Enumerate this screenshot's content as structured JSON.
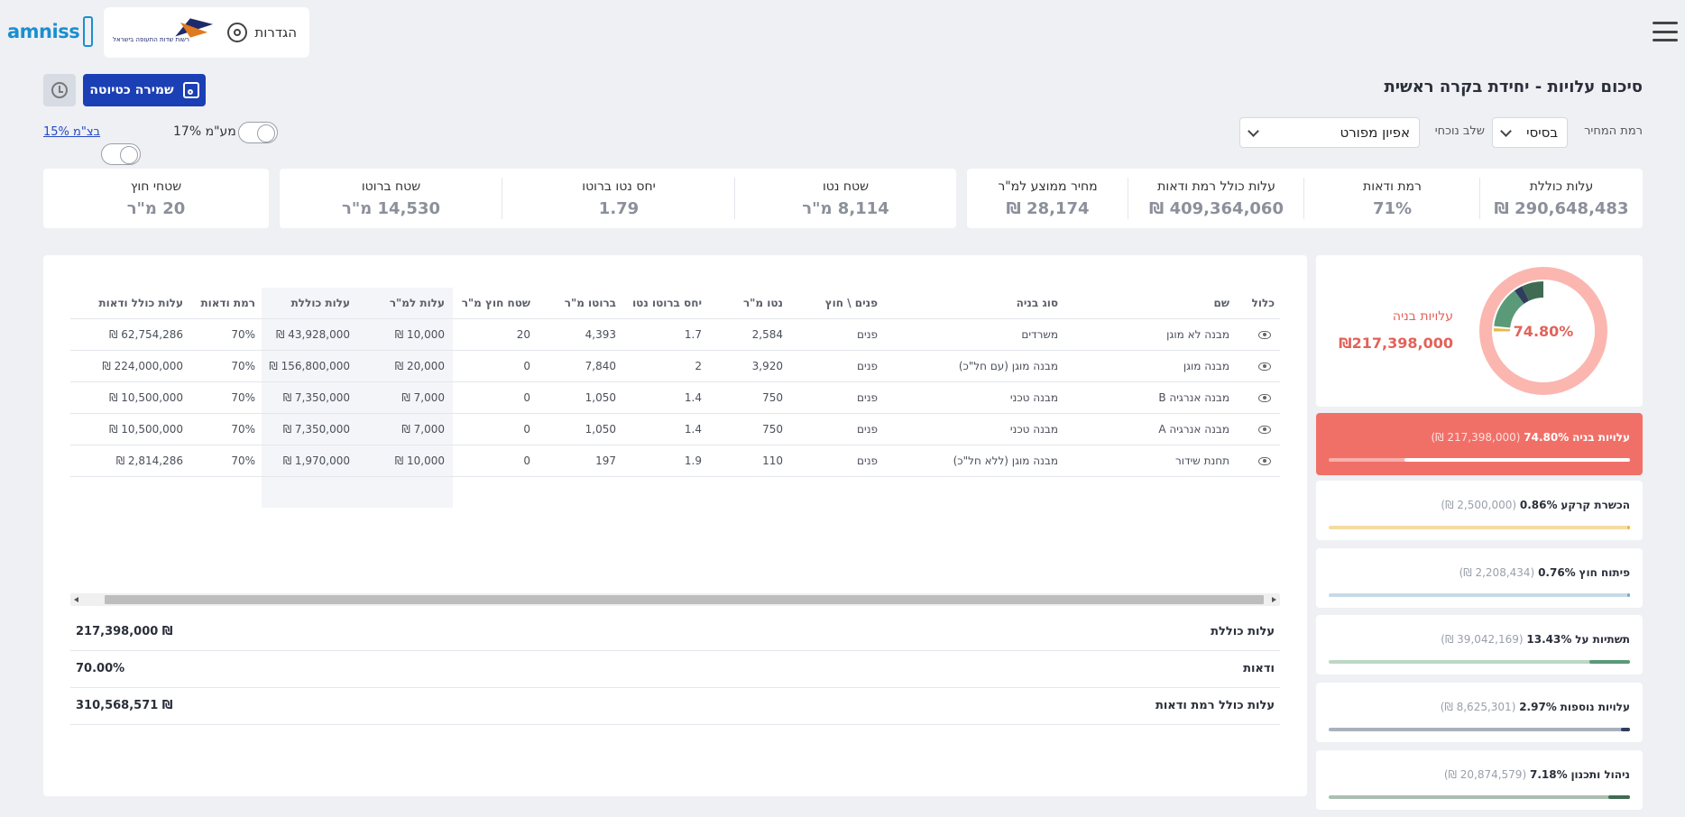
{
  "header": {
    "settings_label": "הגדרות",
    "brand": "amniss",
    "partner_logo_text": "רשות שדות התעופה בישראל",
    "partner_logo_subtext": "ISRAEL AIRPORTS AUTHORITY"
  },
  "toolbar": {
    "page_title": "סיכום עלויות - יחידת בקרה ראשית",
    "save_label": "שמירה כטיוטה",
    "price_level_label": "רמת המחיר",
    "price_level_value": "בסיסי",
    "stage_label": "שלב נוכחי",
    "stage_value": "אפיון מפורט",
    "vat_label": "מע\"מ 17%",
    "contingency_label": "בצ\"מ 15%"
  },
  "stats_a": [
    {
      "label": "עלות כוללת",
      "value": "290,648,483 ₪"
    },
    {
      "label": "רמת ודאות",
      "value": "71%"
    },
    {
      "label": "עלות כולל רמת ודאות",
      "value": "409,364,060 ₪"
    },
    {
      "label": "מחיר ממוצע למ\"ר",
      "value": "28,174 ₪"
    }
  ],
  "stats_b": [
    {
      "label": "שטח נטו",
      "value": "8,114 מ\"ר"
    },
    {
      "label": "יחס נטו ברוטו",
      "value": "1.79"
    },
    {
      "label": "שטח ברוטו",
      "value": "14,530 מ\"ר"
    }
  ],
  "stats_c": [
    {
      "label": "שטחי חוץ",
      "value": "20 מ\"ר"
    }
  ],
  "table": {
    "headers": [
      "כלול",
      "שם",
      "סוג בניה",
      "פנים \\ חוץ",
      "נטו מ\"ר",
      "יחס ברוטו נטו",
      "ברוטו מ\"ר",
      "שטח חוץ מ\"ר",
      "עלות למ\"ר",
      "עלות כוללת",
      "רמת ודאות",
      "עלות כולל ודאות"
    ],
    "rows": [
      [
        "",
        "מבנה לא מוגן",
        "משרדים",
        "פנים",
        "2,584",
        "1.7",
        "4,393",
        "20",
        "10,000 ₪",
        "43,928,000 ₪",
        "70%",
        "62,754,286 ₪"
      ],
      [
        "",
        "מבנה מוגן",
        "מבנה מוגן (עם חל\"כ)",
        "פנים",
        "3,920",
        "2",
        "7,840",
        "0",
        "20,000 ₪",
        "156,800,000 ₪",
        "70%",
        "224,000,000 ₪"
      ],
      [
        "",
        "מבנה אנרגיה B",
        "מבנה טכני",
        "פנים",
        "750",
        "1.4",
        "1,050",
        "0",
        "7,000 ₪",
        "7,350,000 ₪",
        "70%",
        "10,500,000 ₪"
      ],
      [
        "",
        "מבנה אנרגיה A",
        "מבנה טכני",
        "פנים",
        "750",
        "1.4",
        "1,050",
        "0",
        "7,000 ₪",
        "7,350,000 ₪",
        "70%",
        "10,500,000 ₪"
      ],
      [
        "",
        "תחנת שידור",
        "מבנה מוגן (ללא חל\"כ)",
        "פנים",
        "110",
        "1.9",
        "197",
        "0",
        "10,000 ₪",
        "1,970,000 ₪",
        "70%",
        "2,814,286 ₪"
      ]
    ]
  },
  "summary": [
    {
      "label": "עלות כוללת",
      "value": "217,398,000 ₪"
    },
    {
      "label": "ודאות",
      "value": "70.00%"
    },
    {
      "label": "עלות כולל רמת ודאות",
      "value": "310,568,571 ₪"
    }
  ],
  "donut": {
    "center_label": "74.80%",
    "side_label": "עלויות בניה",
    "side_value": "₪217,398,000"
  },
  "categories": [
    {
      "name": "עלויות בניה",
      "pct": "74.80%",
      "amount": "(217,398,000 ₪)",
      "fill": 0.748,
      "color": "#ffffff",
      "track": "#f8b0ab"
    },
    {
      "name": "הכשרת קרקע",
      "pct": "0.86%",
      "amount": "(2,500,000 ₪)",
      "fill": 0.0086,
      "color": "#e8b84a",
      "track": "#f5dca0"
    },
    {
      "name": "פיתוח חוץ",
      "pct": "0.76%",
      "amount": "(2,208,434 ₪)",
      "fill": 0.0076,
      "color": "#7ea9c9",
      "track": "#c6dae8"
    },
    {
      "name": "תשתיות על",
      "pct": "13.43%",
      "amount": "(39,042,169 ₪)",
      "fill": 0.1343,
      "color": "#5a9a78",
      "track": "#bcd6c5"
    },
    {
      "name": "עלויות נוספות",
      "pct": "2.97%",
      "amount": "(8,625,301 ₪)",
      "fill": 0.0297,
      "color": "#2f3e5c",
      "track": "#a9b1bd"
    },
    {
      "name": "ניהול ותכנון",
      "pct": "7.18%",
      "amount": "(20,874,579 ₪)",
      "fill": 0.0718,
      "color": "#3f6b52",
      "track": "#a9bfb0"
    }
  ]
}
